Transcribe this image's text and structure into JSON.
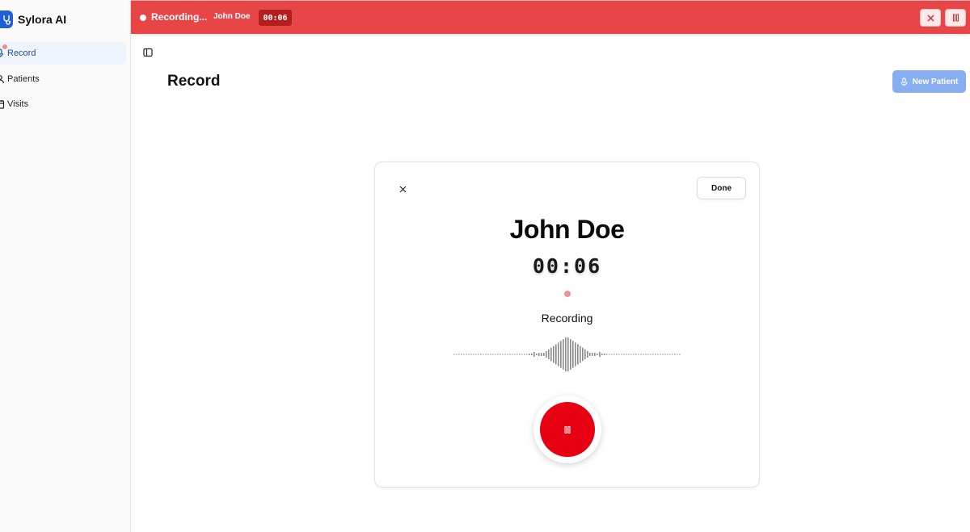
{
  "app": {
    "name": "Sylora AI"
  },
  "sidebar": {
    "items": [
      {
        "label": "Record",
        "icon": "mic-icon",
        "active": true
      },
      {
        "label": "Patients",
        "icon": "user-icon",
        "active": false
      },
      {
        "label": "Visits",
        "icon": "calendar-icon",
        "active": false
      }
    ]
  },
  "banner": {
    "status": "Recording...",
    "patient": "John Doe",
    "timer": "00:06"
  },
  "header": {
    "title": "Record",
    "new_patient_label": "New Patient"
  },
  "recorder": {
    "patient_name": "John Doe",
    "timer": "00:06",
    "status": "Recording",
    "done_label": "Done"
  },
  "colors": {
    "banner": "#e84646",
    "record_button": "#e60012",
    "accent": "#1f5fd6",
    "new_patient_button": "#86aef0"
  }
}
